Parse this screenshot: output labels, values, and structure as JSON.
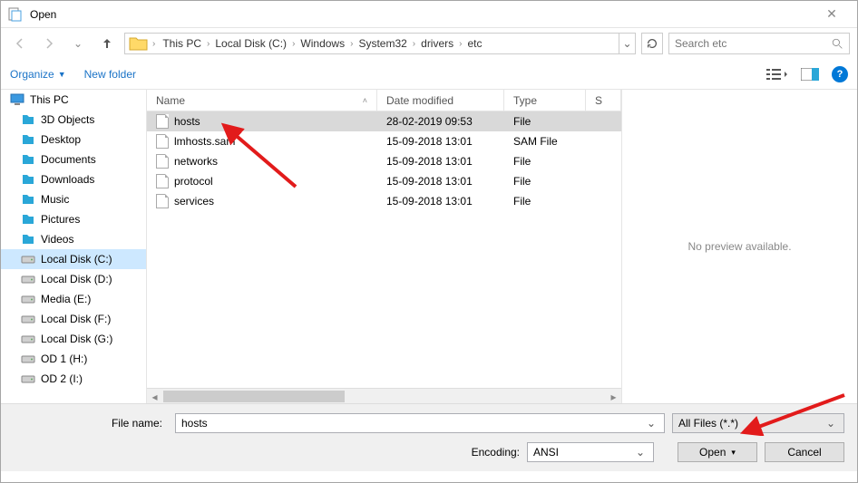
{
  "title": "Open",
  "breadcrumb": [
    "This PC",
    "Local Disk (C:)",
    "Windows",
    "System32",
    "drivers",
    "etc"
  ],
  "search_placeholder": "Search etc",
  "toolbar": {
    "organize": "Organize",
    "newfolder": "New folder"
  },
  "sidebar": {
    "top": "This PC",
    "items": [
      {
        "label": "3D Objects",
        "color": "#2aa7d8"
      },
      {
        "label": "Desktop",
        "color": "#2aa7d8"
      },
      {
        "label": "Documents",
        "color": "#2aa7d8"
      },
      {
        "label": "Downloads",
        "color": "#2aa7d8"
      },
      {
        "label": "Music",
        "color": "#2aa7d8"
      },
      {
        "label": "Pictures",
        "color": "#2aa7d8"
      },
      {
        "label": "Videos",
        "color": "#2aa7d8"
      },
      {
        "label": "Local Disk (C:)",
        "color": "#888",
        "selected": true
      },
      {
        "label": "Local Disk (D:)",
        "color": "#888"
      },
      {
        "label": "Media (E:)",
        "color": "#888"
      },
      {
        "label": "Local Disk (F:)",
        "color": "#888"
      },
      {
        "label": "Local Disk (G:)",
        "color": "#888"
      },
      {
        "label": "OD 1 (H:)",
        "color": "#888"
      },
      {
        "label": "OD 2 (I:)",
        "color": "#888"
      }
    ]
  },
  "columns": {
    "name": "Name",
    "date": "Date modified",
    "type": "Type",
    "size": "S"
  },
  "files": [
    {
      "name": "hosts",
      "date": "28-02-2019 09:53",
      "type": "File",
      "selected": true
    },
    {
      "name": "lmhosts.sam",
      "date": "15-09-2018 13:01",
      "type": "SAM File"
    },
    {
      "name": "networks",
      "date": "15-09-2018 13:01",
      "type": "File"
    },
    {
      "name": "protocol",
      "date": "15-09-2018 13:01",
      "type": "File"
    },
    {
      "name": "services",
      "date": "15-09-2018 13:01",
      "type": "File"
    }
  ],
  "preview_text": "No preview available.",
  "footer": {
    "filename_label": "File name:",
    "filename_value": "hosts",
    "filter": "All Files  (*.*)",
    "encoding_label": "Encoding:",
    "encoding_value": "ANSI",
    "open": "Open",
    "cancel": "Cancel"
  }
}
